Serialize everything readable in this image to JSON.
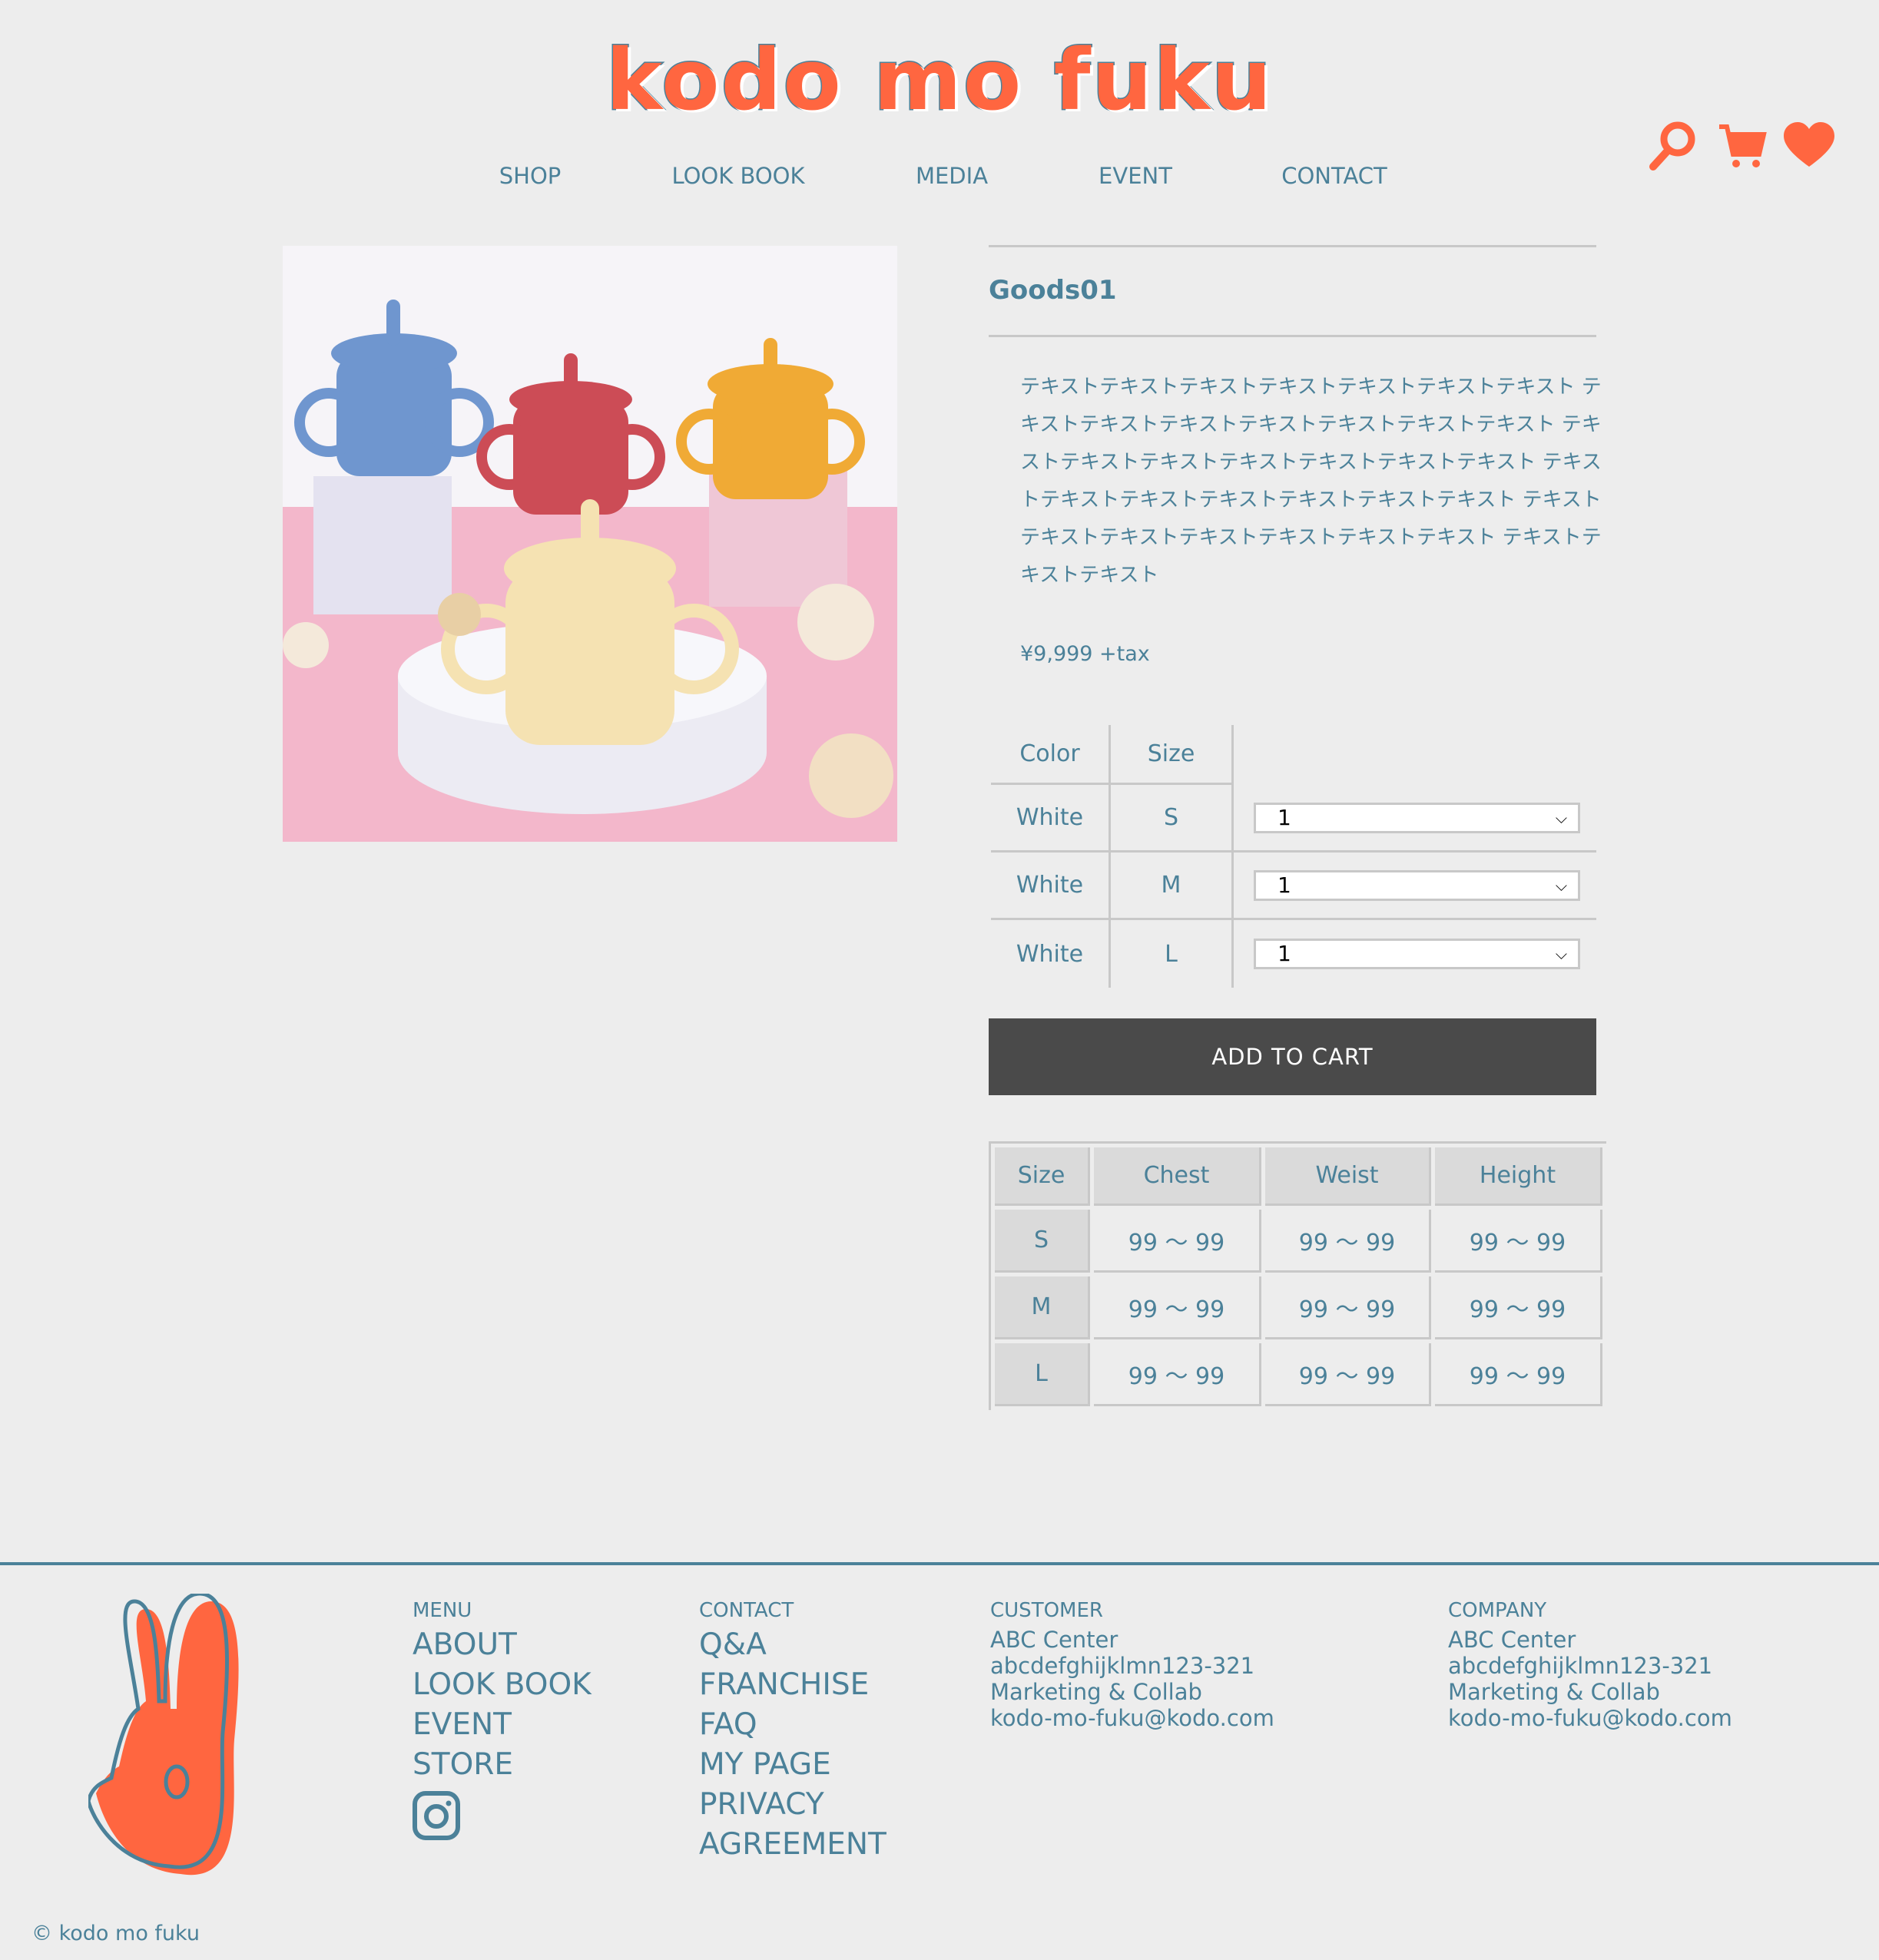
{
  "header": {
    "logo": "kodo mo fuku",
    "nav": [
      "SHOP",
      "LOOK BOOK",
      "MEDIA",
      "EVENT",
      "CONTACT"
    ],
    "icons": [
      "search-icon",
      "cart-icon",
      "heart-icon"
    ]
  },
  "colors": {
    "accent": "#ff6640",
    "text": "#4b8199",
    "button": "#4a4a4a",
    "background": "#ededed"
  },
  "product": {
    "title": "Goods01",
    "description": "テキストテキストテキストテキストテキストテキストテキスト テキストテキストテキストテキストテキストテキストテキスト テキストテキストテキストテキストテキストテキストテキスト テキストテキストテキストテキストテキストテキストテキスト テキストテキストテキストテキストテキストテキストテキスト テキストテキストテキスト",
    "price": "¥9,999 +tax",
    "options": {
      "headers": [
        "Color",
        "Size"
      ],
      "rows": [
        {
          "color": "White",
          "size": "S",
          "qty": "1"
        },
        {
          "color": "White",
          "size": "M",
          "qty": "1"
        },
        {
          "color": "White",
          "size": "L",
          "qty": "1"
        }
      ]
    },
    "add_to_cart": "ADD TO CART",
    "size_chart": {
      "headers": [
        "Size",
        "Chest",
        "Weist",
        "Height"
      ],
      "rows": [
        [
          "S",
          "99 ～ 99",
          "99 ～ 99",
          "99 ～ 99"
        ],
        [
          "M",
          "99 ～ 99",
          "99 ～ 99",
          "99 ～ 99"
        ],
        [
          "L",
          "99 ～ 99",
          "99 ～ 99",
          "99 ～ 99"
        ]
      ]
    }
  },
  "footer": {
    "menu": {
      "heading": "MENU",
      "items": [
        "ABOUT",
        "LOOK BOOK",
        "EVENT",
        "STORE"
      ]
    },
    "contact": {
      "heading": "CONTACT",
      "items": [
        "Q&A",
        "FRANCHISE",
        "FAQ",
        "MY PAGE",
        "PRIVACY",
        "AGREEMENT"
      ]
    },
    "customer": {
      "heading": "CUSTOMER",
      "lines": [
        "ABC Center",
        "abcdefghijklmn123-321",
        "Marketing & Collab",
        "kodo-mo-fuku@kodo.com"
      ]
    },
    "company": {
      "heading": "COMPANY",
      "lines": [
        "ABC Center",
        "abcdefghijklmn123-321",
        "Marketing & Collab",
        "kodo-mo-fuku@kodo.com"
      ]
    },
    "copyright": "© kodo mo fuku"
  }
}
